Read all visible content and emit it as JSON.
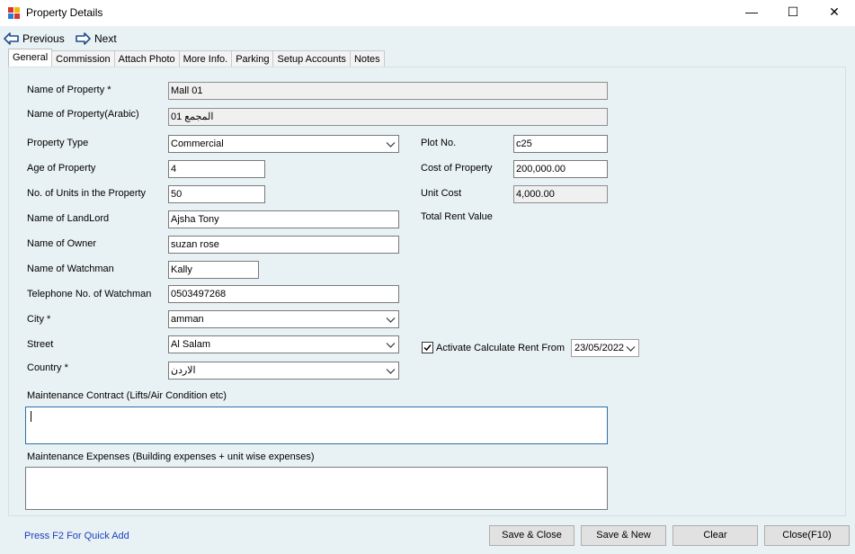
{
  "window": {
    "title": "Property Details",
    "minimize": "—",
    "maximize": "☐",
    "close": "✕"
  },
  "nav": {
    "previous": "Previous",
    "next": "Next"
  },
  "tabs": [
    "General",
    "Commission",
    "Attach Photo",
    "More Info.",
    "Parking",
    "Setup Accounts",
    "Notes"
  ],
  "form": {
    "name_of_property": {
      "label": "Name of Property *",
      "value": "Mall 01"
    },
    "name_arabic": {
      "label": "Name of Property(Arabic)",
      "value": "المجمع 01"
    },
    "property_type": {
      "label": "Property Type",
      "value": "Commercial"
    },
    "age": {
      "label": "Age of Property",
      "value": "4"
    },
    "units": {
      "label": "No. of Units in the Property",
      "value": "50"
    },
    "landlord": {
      "label": "Name of LandLord",
      "value": "Ajsha Tony"
    },
    "owner": {
      "label": "Name of Owner",
      "value": "suzan rose"
    },
    "watchman": {
      "label": "Name of Watchman",
      "value": "Kally"
    },
    "watchman_phone": {
      "label": "Telephone No. of Watchman",
      "value": "0503497268"
    },
    "city": {
      "label": "City *",
      "value": "amman"
    },
    "street": {
      "label": "Street",
      "value": "Al Salam"
    },
    "country": {
      "label": "Country *",
      "value": "الاردن"
    },
    "plot_no": {
      "label": "Plot No.",
      "value": "c25"
    },
    "cost": {
      "label": "Cost of Property",
      "value": "200,000.00"
    },
    "unit_cost": {
      "label": "Unit Cost",
      "value": "4,000.00"
    },
    "total_rent": {
      "label": "Total Rent Value"
    },
    "activate_rent": {
      "label": "Activate Calculate Rent From",
      "checked": true,
      "date": "23/05/2022"
    },
    "maintenance_contract": {
      "label": "Maintenance Contract (Lifts/Air Condition etc)",
      "value": ""
    },
    "maintenance_expenses": {
      "label": "Maintenance Expenses (Building expenses + unit wise expenses)",
      "value": ""
    }
  },
  "footer": {
    "hint": "Press F2 For Quick Add",
    "save_close": "Save & Close",
    "save_new": "Save & New",
    "clear": "Clear",
    "close": "Close(F10)"
  },
  "colors": {
    "background": "#e8f1f3",
    "link": "#1d3fbf",
    "nav_arrow": "#1f4e8c"
  }
}
